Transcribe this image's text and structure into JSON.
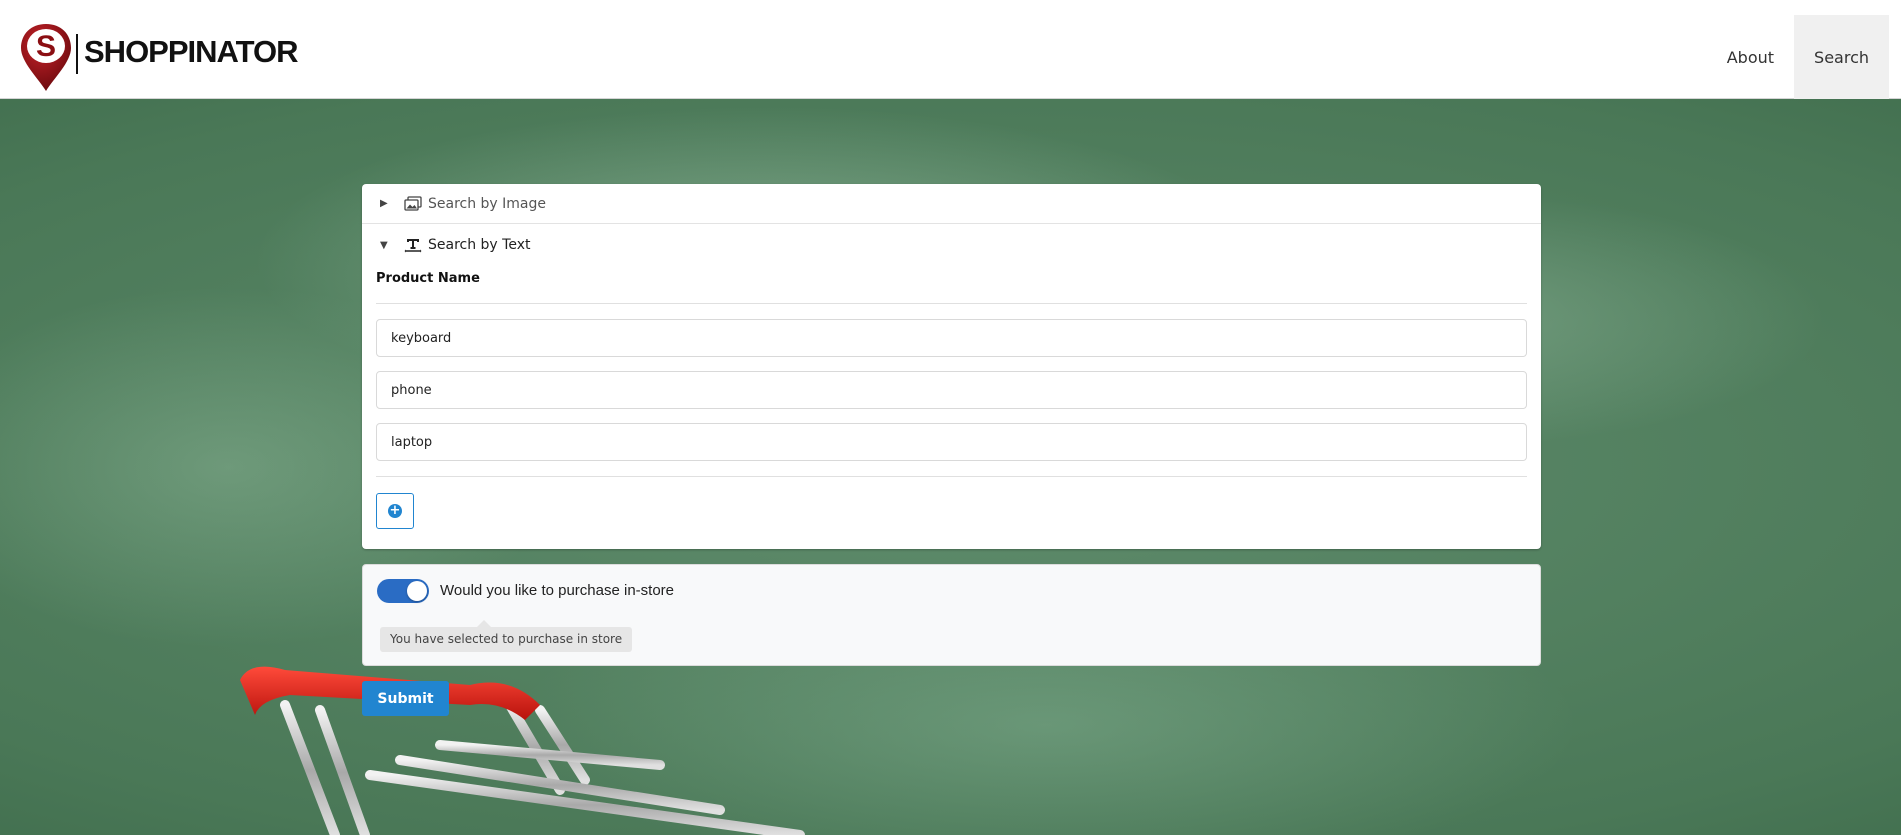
{
  "app": {
    "brand": "SHOPPINATOR",
    "logo_letter": "S",
    "brand_color": "#8b0e12"
  },
  "nav": {
    "items": [
      {
        "label": "About",
        "active": false
      },
      {
        "label": "Search",
        "active": true
      }
    ]
  },
  "search_panel": {
    "image_section": {
      "title": "Search by Image",
      "expanded": false
    },
    "text_section": {
      "title": "Search by Text",
      "expanded": true,
      "field_label": "Product Name",
      "inputs": [
        {
          "value": "keyboard"
        },
        {
          "value": "phone"
        },
        {
          "value": "laptop"
        }
      ],
      "add_button_icon": "plus-circle-icon"
    }
  },
  "in_store": {
    "toggle_on": true,
    "question": "Would you like to purchase in-store",
    "tooltip": "You have selected to purchase in store"
  },
  "submit": {
    "label": "Submit"
  },
  "colors": {
    "accent": "#2185d0",
    "toggle": "#2a6cc4",
    "background": "#4a7857"
  }
}
